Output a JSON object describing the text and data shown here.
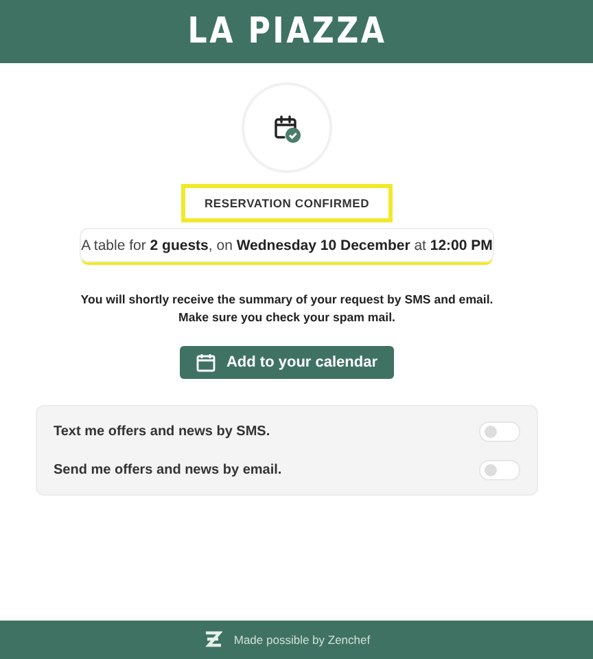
{
  "header": {
    "brand": "LA PIAZZA"
  },
  "confirmation": {
    "title": "RESERVATION CONFIRMED",
    "summary": "A table for **2 guests**, on **Wednesday 10 December** at **12:00 PM**",
    "message": [
      "You will shortly receive the summary of your request by SMS and email.",
      "Make sure you check your spam mail."
    ],
    "button": "Add to your calendar"
  },
  "options": [
    {
      "label": "Text me offers and news by SMS.",
      "on": false
    },
    {
      "label": "Send me offers and news by email.",
      "on": false
    }
  ],
  "footer": {
    "text": "Made possible by Zenchef"
  }
}
